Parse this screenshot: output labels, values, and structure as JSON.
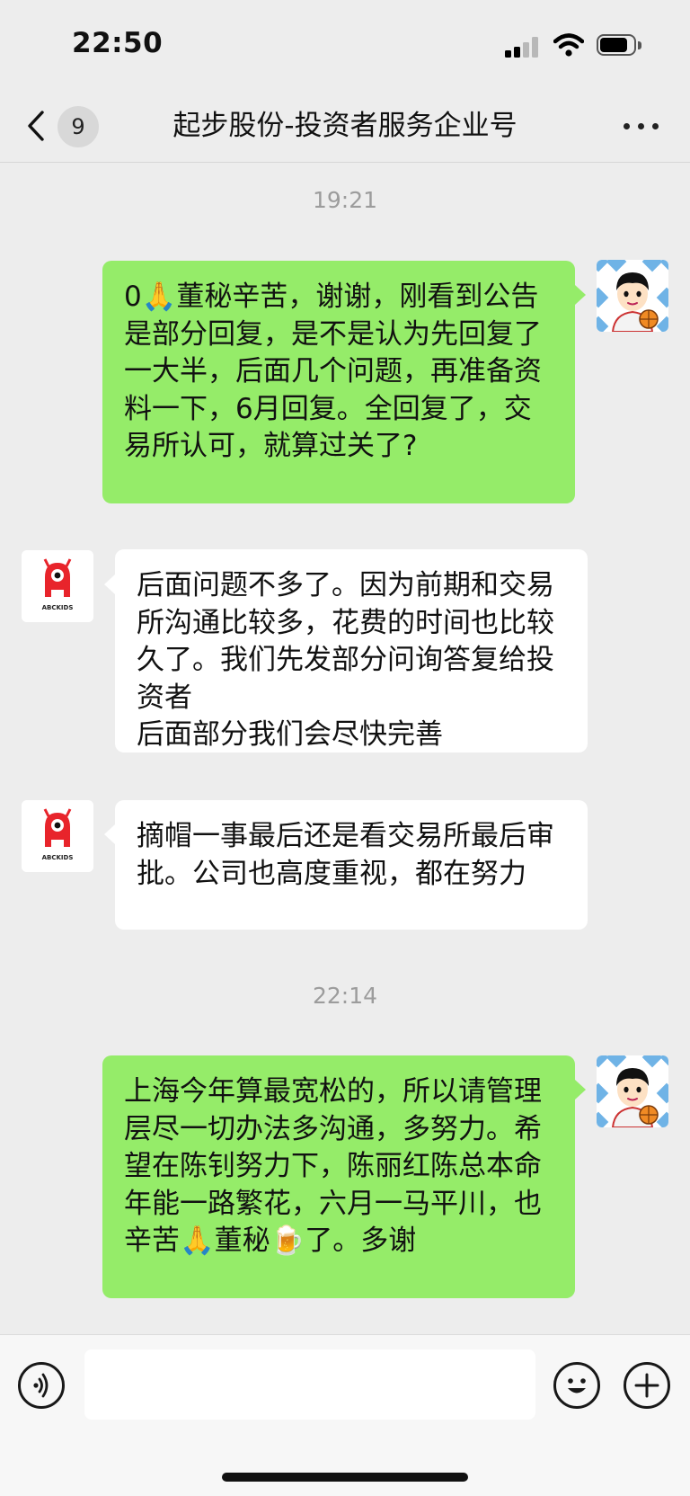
{
  "status_bar": {
    "time": "22:50"
  },
  "header": {
    "unread_count": "9",
    "title": "起步股份-投资者服务企业号"
  },
  "messages": [
    {
      "kind": "time",
      "text": "19:21"
    },
    {
      "kind": "outgoing",
      "text": "0🙏董秘辛苦，谢谢，刚看到公告是部分回复，是不是认为先回复了一大半，后面几个问题，再准备资料一下，6月回复。全回复了，交易所认可，就算过关了?"
    },
    {
      "kind": "incoming",
      "avatar_text": "ABCKIDS",
      "text": "后面问题不多了。因为前期和交易所沟通比较多，花费的时间也比较久了。我们先发部分问询答复给投资者\n后面部分我们会尽快完善"
    },
    {
      "kind": "incoming",
      "avatar_text": "ABCKIDS",
      "text": "摘帽一事最后还是看交易所最后审批。公司也高度重视，都在努力"
    },
    {
      "kind": "time",
      "text": "22:14"
    },
    {
      "kind": "outgoing",
      "text": "上海今年算最宽松的，所以请管理层尽一切办法多沟通，多努力。希望在陈钊努力下，陈丽红陈总本命年能一路繁花，六月一马平川，也辛苦🙏董秘🍺了。多谢"
    }
  ],
  "colors": {
    "outgoing_bubble": "#95ec69",
    "incoming_bubble": "#ffffff",
    "background": "#ededed",
    "brand_red": "#e8242b"
  },
  "icons": {
    "back": "chevron-left-icon",
    "more": "more-dots-icon",
    "voice": "voice-icon",
    "emoji": "emoji-icon",
    "add": "plus-icon"
  }
}
